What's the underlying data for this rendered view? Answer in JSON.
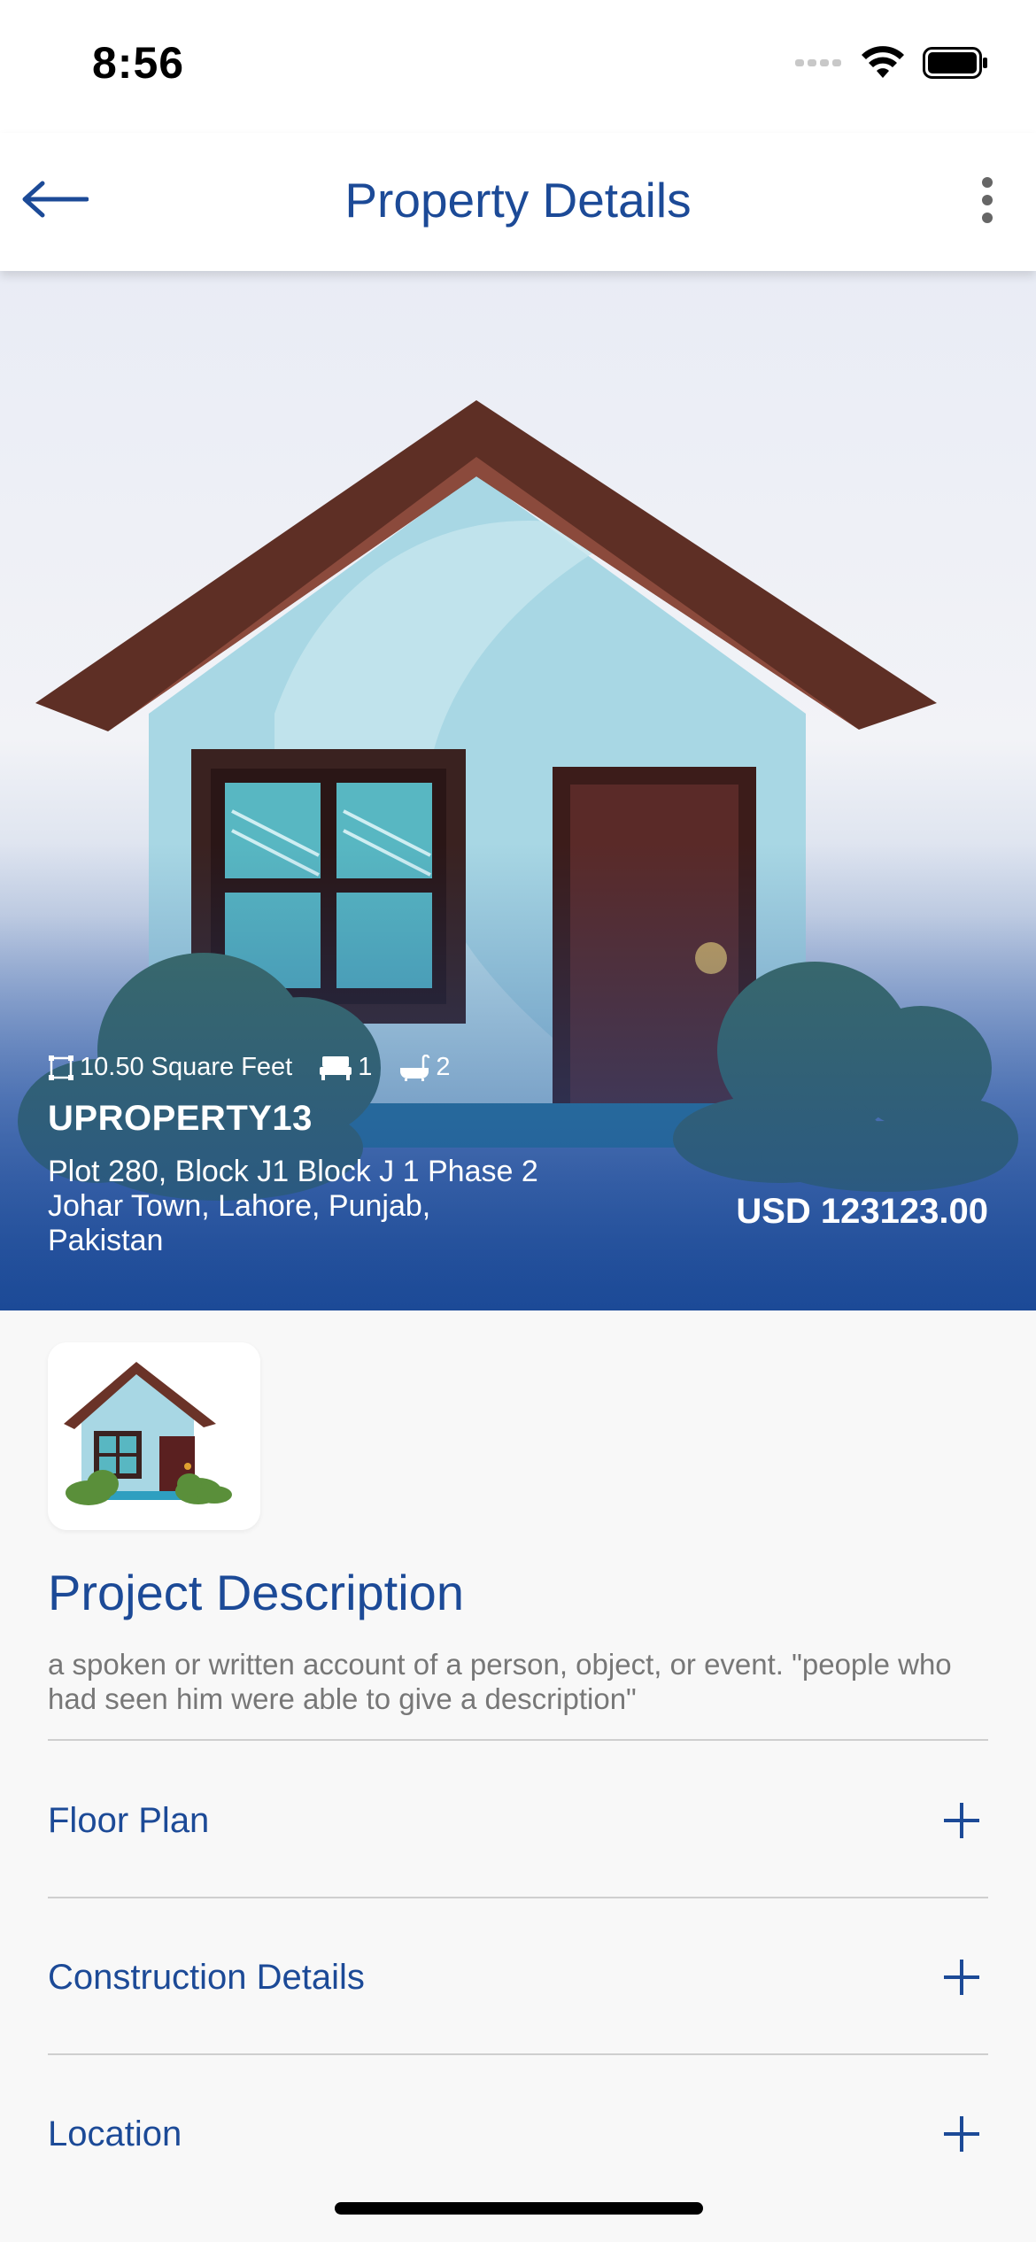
{
  "status_bar": {
    "time": "8:56"
  },
  "header": {
    "title": "Property Details"
  },
  "property": {
    "area": "10.50 Square Feet",
    "bedrooms": "1",
    "bathrooms": "2",
    "name": "UPROPERTY13",
    "address": "Plot 280, Block J1 Block J 1 Phase 2 Johar Town, Lahore, Punjab, Pakistan",
    "price": "USD 123123.00"
  },
  "description": {
    "title": "Project Description",
    "text": "a spoken or written account of a person, object, or event. \"people who had seen him were able to give a description\""
  },
  "sections": [
    {
      "label": "Floor Plan"
    },
    {
      "label": "Construction Details"
    },
    {
      "label": "Location"
    }
  ],
  "icons": {
    "back": "arrow-left-icon",
    "more": "more-vertical-icon",
    "area": "area-icon",
    "bed": "bed-icon",
    "bath": "bathtub-icon",
    "expand": "plus-icon"
  },
  "colors": {
    "primary": "#1c4a97",
    "text_secondary": "#777777",
    "background": "#f8f8f8"
  }
}
